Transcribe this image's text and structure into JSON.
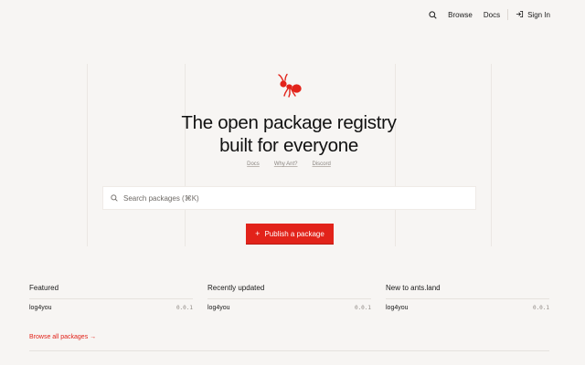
{
  "nav": {
    "browse_label": "Browse",
    "docs_label": "Docs",
    "signin_label": "Sign In"
  },
  "hero": {
    "title_line1": "The open package registry",
    "title_line2": "built for everyone",
    "links": [
      "Docs",
      "Why Ant?",
      "Discord"
    ]
  },
  "search": {
    "placeholder": "Search packages (⌘K)"
  },
  "publish_label": "Publish a package",
  "columns": [
    {
      "heading": "Featured",
      "package": "log4you",
      "version": "0.0.1"
    },
    {
      "heading": "Recently updated",
      "package": "log4you",
      "version": "0.0.1"
    },
    {
      "heading": "New to ants.land",
      "package": "log4you",
      "version": "0.0.1"
    }
  ],
  "browse_all_label": "Browse all packages →",
  "colors": {
    "accent": "#e2231a",
    "background": "#f7f5f3"
  }
}
